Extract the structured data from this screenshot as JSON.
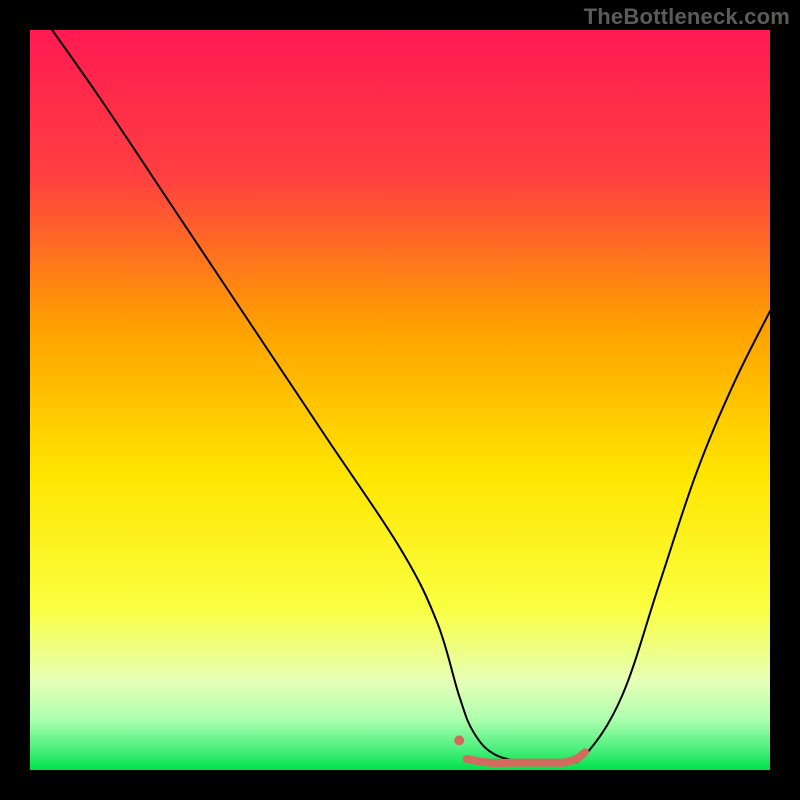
{
  "attribution": "TheBottleneck.com",
  "chart_data": {
    "type": "line",
    "title": "",
    "xlabel": "",
    "ylabel": "",
    "xlim": [
      0,
      100
    ],
    "ylim": [
      0,
      100
    ],
    "grid": false,
    "legend": false,
    "background_gradient": {
      "stops": [
        {
          "offset": 0.0,
          "color": "#ff1a52"
        },
        {
          "offset": 0.2,
          "color": "#ff4040"
        },
        {
          "offset": 0.4,
          "color": "#ffa000"
        },
        {
          "offset": 0.6,
          "color": "#ffe600"
        },
        {
          "offset": 0.78,
          "color": "#faff40"
        },
        {
          "offset": 0.88,
          "color": "#e6ffb6"
        },
        {
          "offset": 0.93,
          "color": "#b0ffb0"
        },
        {
          "offset": 0.97,
          "color": "#50f080"
        },
        {
          "offset": 1.0,
          "color": "#00e04b"
        }
      ]
    },
    "series": [
      {
        "name": "bottleneck-curve",
        "color": "#000000",
        "stroke_width": 2,
        "x": [
          3,
          10,
          20,
          30,
          40,
          50,
          55,
          58,
          60,
          63,
          68,
          72,
          75,
          80,
          85,
          90,
          95,
          100
        ],
        "values": [
          100,
          90,
          75,
          60,
          45,
          30,
          20,
          10,
          5,
          2,
          1,
          1,
          2,
          10,
          25,
          40,
          52,
          62
        ]
      }
    ],
    "annotations": [
      {
        "name": "optimal-marker",
        "color": "#d46a5e",
        "dot": {
          "x": 58,
          "y": 4
        },
        "stroke_width": 8,
        "x": [
          59,
          62,
          66,
          70,
          72,
          73,
          74,
          75
        ],
        "values": [
          1.5,
          1,
          1,
          1,
          1,
          1.2,
          1.6,
          2.4
        ]
      }
    ]
  }
}
